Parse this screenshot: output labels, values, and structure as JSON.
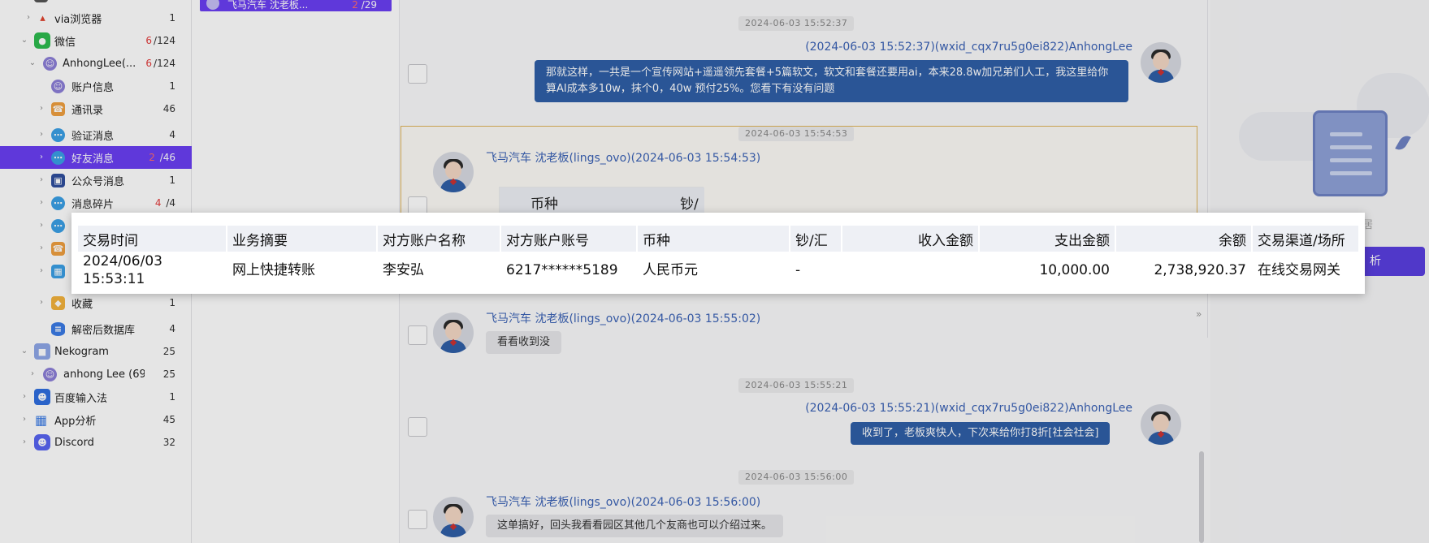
{
  "sidebar": {
    "items": [
      {
        "label": "via浏览器",
        "count": "1",
        "unread": ""
      },
      {
        "label": "微信",
        "count": "/124",
        "unread": "6"
      },
      {
        "label": "AnhongLee(...",
        "count": "/124",
        "unread": "6"
      },
      {
        "label": "账户信息",
        "count": "1",
        "unread": ""
      },
      {
        "label": "通讯录",
        "count": "46",
        "unread": ""
      },
      {
        "label": "验证消息",
        "count": "4",
        "unread": ""
      },
      {
        "label": "好友消息",
        "count": "/46",
        "unread": "2"
      },
      {
        "label": "公众号消息",
        "count": "1",
        "unread": ""
      },
      {
        "label": "消息碎片",
        "count": "/4",
        "unread": "4"
      },
      {
        "label": "收藏",
        "count": "1",
        "unread": ""
      },
      {
        "label": "解密后数据库",
        "count": "4",
        "unread": ""
      },
      {
        "label": "Nekogram",
        "count": "25",
        "unread": ""
      },
      {
        "label": "anhong Lee (69...",
        "count": "25",
        "unread": ""
      },
      {
        "label": "百度输入法",
        "count": "1",
        "unread": ""
      },
      {
        "label": "App分析",
        "count": "45",
        "unread": ""
      },
      {
        "label": "Discord",
        "count": "32",
        "unread": ""
      }
    ]
  },
  "conversation": {
    "selected_title": "飞马汽车 沈老板...",
    "selected_unread": "2",
    "selected_count": "/29"
  },
  "chat": {
    "messages": [
      {
        "timestamp": "2024-06-03 15:52:37",
        "sender": "(2024-06-03 15:52:37)(wxid_cqx7ru5g0ei822)AnhongLee",
        "text": "那就这样，一共是一个宣传网站+遥遥领先套餐+5篇软文，软文和套餐还要用ai，本来28.8w加兄弟们人工，我这里给你算AI成本多10w，抹个0，40w 预付25%。您看下有没有问题"
      },
      {
        "timestamp": "2024-06-03 15:54:53",
        "sender": "飞马汽车 沈老板(lings_ovo)(2024-06-03 15:54:53)",
        "text": ""
      },
      {
        "timestamp": "2024-06-03 15:55:02",
        "sender": "飞马汽车 沈老板(lings_ovo)(2024-06-03 15:55:02)",
        "text": "看看收到没"
      },
      {
        "timestamp": "2024-06-03 15:55:21",
        "sender": "(2024-06-03 15:55:21)(wxid_cqx7ru5g0ei822)AnhongLee",
        "text": "收到了，老板爽快人，下次来给你打8折[社会社会]"
      },
      {
        "timestamp": "2024-06-03 15:56:00",
        "sender": "飞马汽车 沈老板(lings_ovo)(2024-06-03 15:56:00)",
        "text": "这单搞好，回头我看看园区其他几个友商也可以介绍过来。"
      }
    ],
    "image_peek_headers": [
      "币种",
      "钞/汇"
    ]
  },
  "right_panel": {
    "empty_label": "居",
    "analyze_button": "析"
  },
  "transaction": {
    "headers": [
      "交易时间",
      "业务摘要",
      "对方账户名称",
      "对方账户账号",
      "币种",
      "钞/汇",
      "收入金额",
      "支出金额",
      "余额",
      "交易渠道/场所"
    ],
    "row": {
      "date": "2024/06/03",
      "time": "15:53:11",
      "summary": "网上快捷转账",
      "counterparty_name": "李安弘",
      "counterparty_account": "6217******5189",
      "currency": "人民币元",
      "cash_remit": "-",
      "income": "",
      "expense": "10,000.00",
      "balance": "2,738,920.37",
      "channel": "在线交易网关"
    }
  },
  "colors": {
    "accent": "#6a3ff3",
    "outgoing_bubble": "#2f5fa8",
    "sender_name": "#3b63b6",
    "unread": "#e23a3a",
    "highlight_border": "#e0b55a"
  }
}
